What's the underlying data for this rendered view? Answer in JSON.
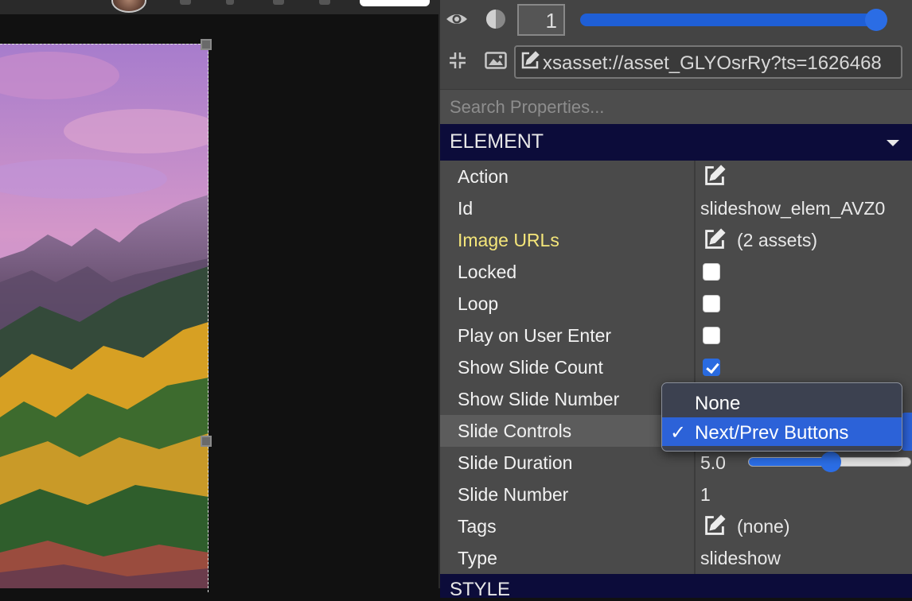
{
  "toolbar": {
    "opacity_value": "1",
    "opacity_level": 1.0,
    "asset_url": "xsasset://asset_GLYOsrRy?ts=1626468"
  },
  "search": {
    "placeholder": "Search Properties..."
  },
  "sections": {
    "element_title": "ELEMENT",
    "style_title": "STYLE"
  },
  "properties": [
    {
      "label": "Action",
      "type": "edit",
      "value": ""
    },
    {
      "label": "Id",
      "type": "text",
      "value": "slideshow_elem_AVZ0"
    },
    {
      "label": "Image URLs",
      "type": "edit",
      "value": "(2 assets)"
    },
    {
      "label": "Locked",
      "type": "checkbox",
      "checked": false
    },
    {
      "label": "Loop",
      "type": "checkbox",
      "checked": false
    },
    {
      "label": "Play on User Enter",
      "type": "checkbox",
      "checked": false
    },
    {
      "label": "Show Slide Count",
      "type": "checkbox",
      "checked": true
    },
    {
      "label": "Show Slide Number",
      "type": "checkbox",
      "checked": false
    },
    {
      "label": "Slide Controls",
      "type": "select",
      "value": "Next/Prev Buttons"
    },
    {
      "label": "Slide Duration",
      "type": "slider",
      "value": "5.0",
      "level": 0.5
    },
    {
      "label": "Slide Number",
      "type": "text",
      "value": "1"
    },
    {
      "label": "Tags",
      "type": "edit",
      "value": "(none)"
    },
    {
      "label": "Type",
      "type": "text",
      "value": "slideshow"
    }
  ],
  "dropdown": {
    "options": [
      {
        "label": "None",
        "selected": false
      },
      {
        "label": "Next/Prev Buttons",
        "selected": true
      }
    ],
    "check_glyph": "✓"
  },
  "colors": {
    "accent": "#2b6de5",
    "section_header": "#0c0c3a",
    "modified_label": "#f5e67a"
  },
  "icons": [
    "eye-icon",
    "contrast-icon",
    "collapse-icon",
    "image-icon",
    "edit-icon",
    "chevron-down-icon",
    "checkmark-icon"
  ]
}
